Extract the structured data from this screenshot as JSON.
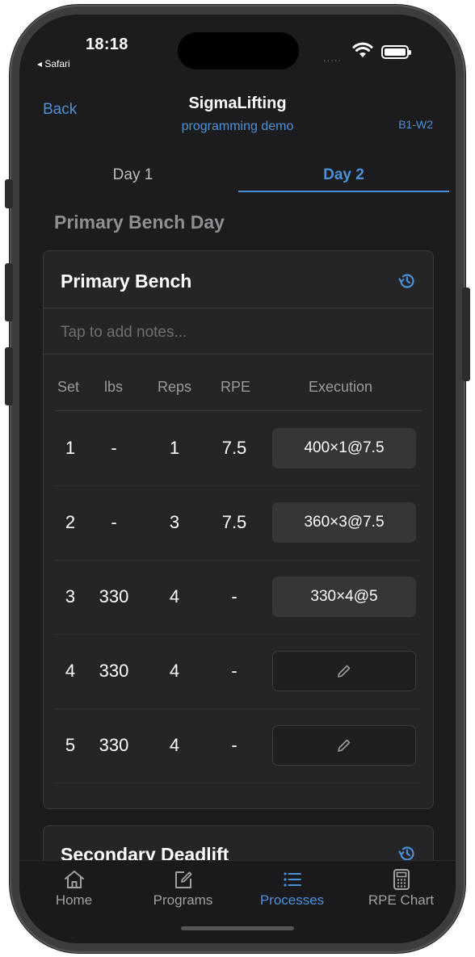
{
  "status": {
    "time": "18:18",
    "back_app": "◂ Safari",
    "signal": "....."
  },
  "nav": {
    "back_label": "Back",
    "title": "SigmaLifting",
    "subtitle": "programming demo",
    "week": "B1-W2"
  },
  "tabs": [
    {
      "label": "Day 1",
      "active": false
    },
    {
      "label": "Day 2",
      "active": true
    }
  ],
  "day_title": "Primary Bench Day",
  "exercise": {
    "name": "Primary Bench",
    "history_icon": "history-icon",
    "notes_placeholder": "Tap to add notes...",
    "columns": [
      "Set",
      "lbs",
      "Reps",
      "RPE",
      "Execution"
    ],
    "sets": [
      {
        "set": "1",
        "lbs": "-",
        "reps": "1",
        "rpe": "7.5",
        "execution": "400×1@7.5"
      },
      {
        "set": "2",
        "lbs": "-",
        "reps": "3",
        "rpe": "7.5",
        "execution": "360×3@7.5"
      },
      {
        "set": "3",
        "lbs": "330",
        "reps": "4",
        "rpe": "-",
        "execution": "330×4@5"
      },
      {
        "set": "4",
        "lbs": "330",
        "reps": "4",
        "rpe": "-",
        "execution": ""
      },
      {
        "set": "5",
        "lbs": "330",
        "reps": "4",
        "rpe": "-",
        "execution": ""
      }
    ]
  },
  "next_exercise": {
    "name": "Secondary Deadlift"
  },
  "tabbar": [
    {
      "label": "Home",
      "icon": "home-icon",
      "active": false
    },
    {
      "label": "Programs",
      "icon": "edit-icon",
      "active": false
    },
    {
      "label": "Processes",
      "icon": "list-icon",
      "active": true
    },
    {
      "label": "RPE Chart",
      "icon": "calculator-icon",
      "active": false
    }
  ],
  "colors": {
    "accent": "#4a90d9",
    "background": "#1c1c1e",
    "card": "#252527",
    "frame": "#3d3d3f"
  }
}
